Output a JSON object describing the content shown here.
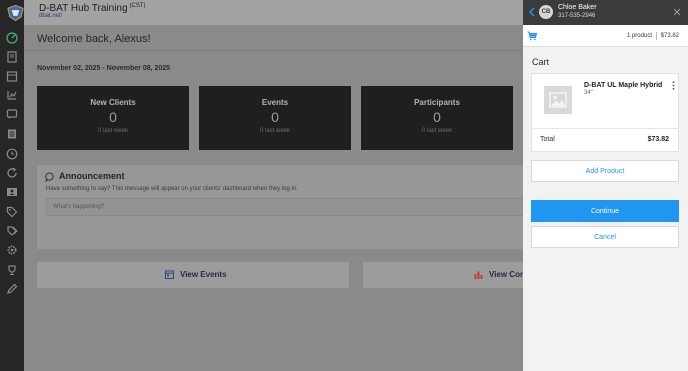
{
  "org": {
    "title": "D-BAT Hub Training",
    "timezone": "(CST)",
    "link": "dbat.net/",
    "logo_icon": "shield-logo-icon"
  },
  "sidebar": {
    "icons": [
      "dashboard-icon",
      "book-icon",
      "calendar-icon",
      "chart-icon",
      "chat-icon",
      "list-icon",
      "clock-icon",
      "refresh-icon",
      "id-card-icon",
      "tag-icon",
      "tags-icon",
      "gear-icon",
      "trophy-icon",
      "edit-icon"
    ]
  },
  "welcome": "Welcome back, Alexus!",
  "date_range": "November 02, 2025 - November 08, 2025",
  "stats": [
    {
      "title": "New Clients",
      "value": "0",
      "sub": "0 last week"
    },
    {
      "title": "Events",
      "value": "0",
      "sub": "0 last week"
    },
    {
      "title": "Participants",
      "value": "0",
      "sub": "0 last week"
    }
  ],
  "announcement": {
    "title": "Announcement",
    "description": "Have something to say? This message will appear on your clients' dashboard when they log in.",
    "placeholder": "What's happening?"
  },
  "actions": [
    {
      "label": "View Events",
      "icon": "calendar-icon"
    },
    {
      "label": "View Cont",
      "icon": "bar-chart-icon"
    }
  ],
  "panel": {
    "customer": {
      "initials": "CB",
      "name": "Chloe Baker",
      "phone": "317-535-2946"
    },
    "summary": {
      "count": "1 product",
      "total": "$73.82"
    },
    "heading": "Cart",
    "item": {
      "name": "D-BAT UL Maple Hybrid",
      "variant": "34\""
    },
    "total_label": "Total",
    "total_value": "$73.82",
    "add_label": "Add Product",
    "continue_label": "Continue",
    "cancel_label": "Cancel"
  },
  "colors": {
    "accent": "#2196f3",
    "header": "#3b3b3b",
    "rail": "#262626"
  }
}
